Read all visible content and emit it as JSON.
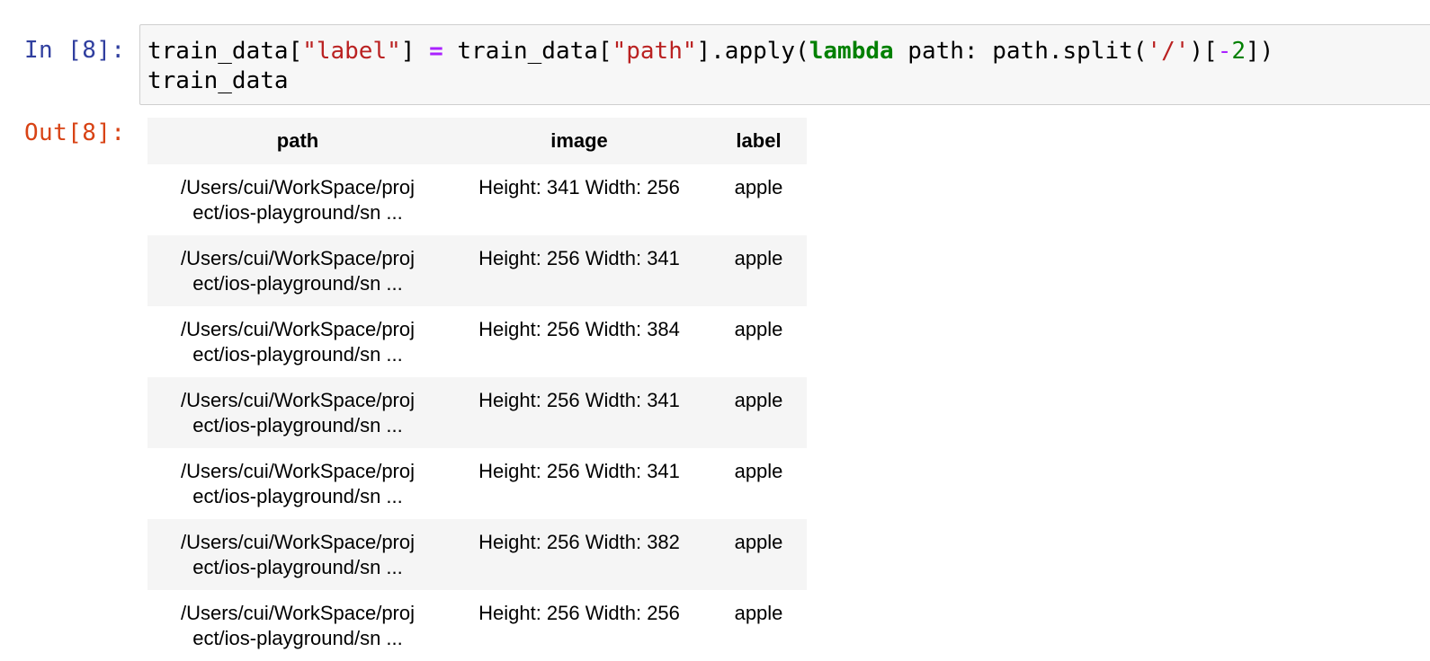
{
  "input_cell": {
    "prompt": "In [8]:",
    "code_line_1": {
      "t1": "train_data[",
      "t2": "\"label\"",
      "t3": "] ",
      "t4": "=",
      "t5": " train_data[",
      "t6": "\"path\"",
      "t7": "].apply(",
      "t8": "lambda",
      "t9": " path: path.split(",
      "t10": "'/'",
      "t11": ")[",
      "t12": "-",
      "t13": "2",
      "t14": "])"
    },
    "code_line_2": "train_data"
  },
  "output_cell": {
    "prompt": "Out[8]:",
    "table": {
      "columns": [
        "path",
        "image",
        "label"
      ],
      "rows": [
        {
          "path_line1": "/Users/cui/WorkSpace/proj",
          "path_line2": "ect/ios-playground/sn ...",
          "image": "Height: 341 Width: 256",
          "label": "apple"
        },
        {
          "path_line1": "/Users/cui/WorkSpace/proj",
          "path_line2": "ect/ios-playground/sn ...",
          "image": "Height: 256 Width: 341",
          "label": "apple"
        },
        {
          "path_line1": "/Users/cui/WorkSpace/proj",
          "path_line2": "ect/ios-playground/sn ...",
          "image": "Height: 256 Width: 384",
          "label": "apple"
        },
        {
          "path_line1": "/Users/cui/WorkSpace/proj",
          "path_line2": "ect/ios-playground/sn ...",
          "image": "Height: 256 Width: 341",
          "label": "apple"
        },
        {
          "path_line1": "/Users/cui/WorkSpace/proj",
          "path_line2": "ect/ios-playground/sn ...",
          "image": "Height: 256 Width: 341",
          "label": "apple"
        },
        {
          "path_line1": "/Users/cui/WorkSpace/proj",
          "path_line2": "ect/ios-playground/sn ...",
          "image": "Height: 256 Width: 382",
          "label": "apple"
        },
        {
          "path_line1": "/Users/cui/WorkSpace/proj",
          "path_line2": "ect/ios-playground/sn ...",
          "image": "Height: 256 Width: 256",
          "label": "apple"
        }
      ]
    }
  },
  "colors": {
    "in_prompt": "#303f9f",
    "out_prompt": "#d84315",
    "string": "#ba2121",
    "keyword": "#008000",
    "operator": "#aa22ff",
    "cell_background": "#f7f7f7",
    "row_stripe": "#f5f5f5"
  }
}
